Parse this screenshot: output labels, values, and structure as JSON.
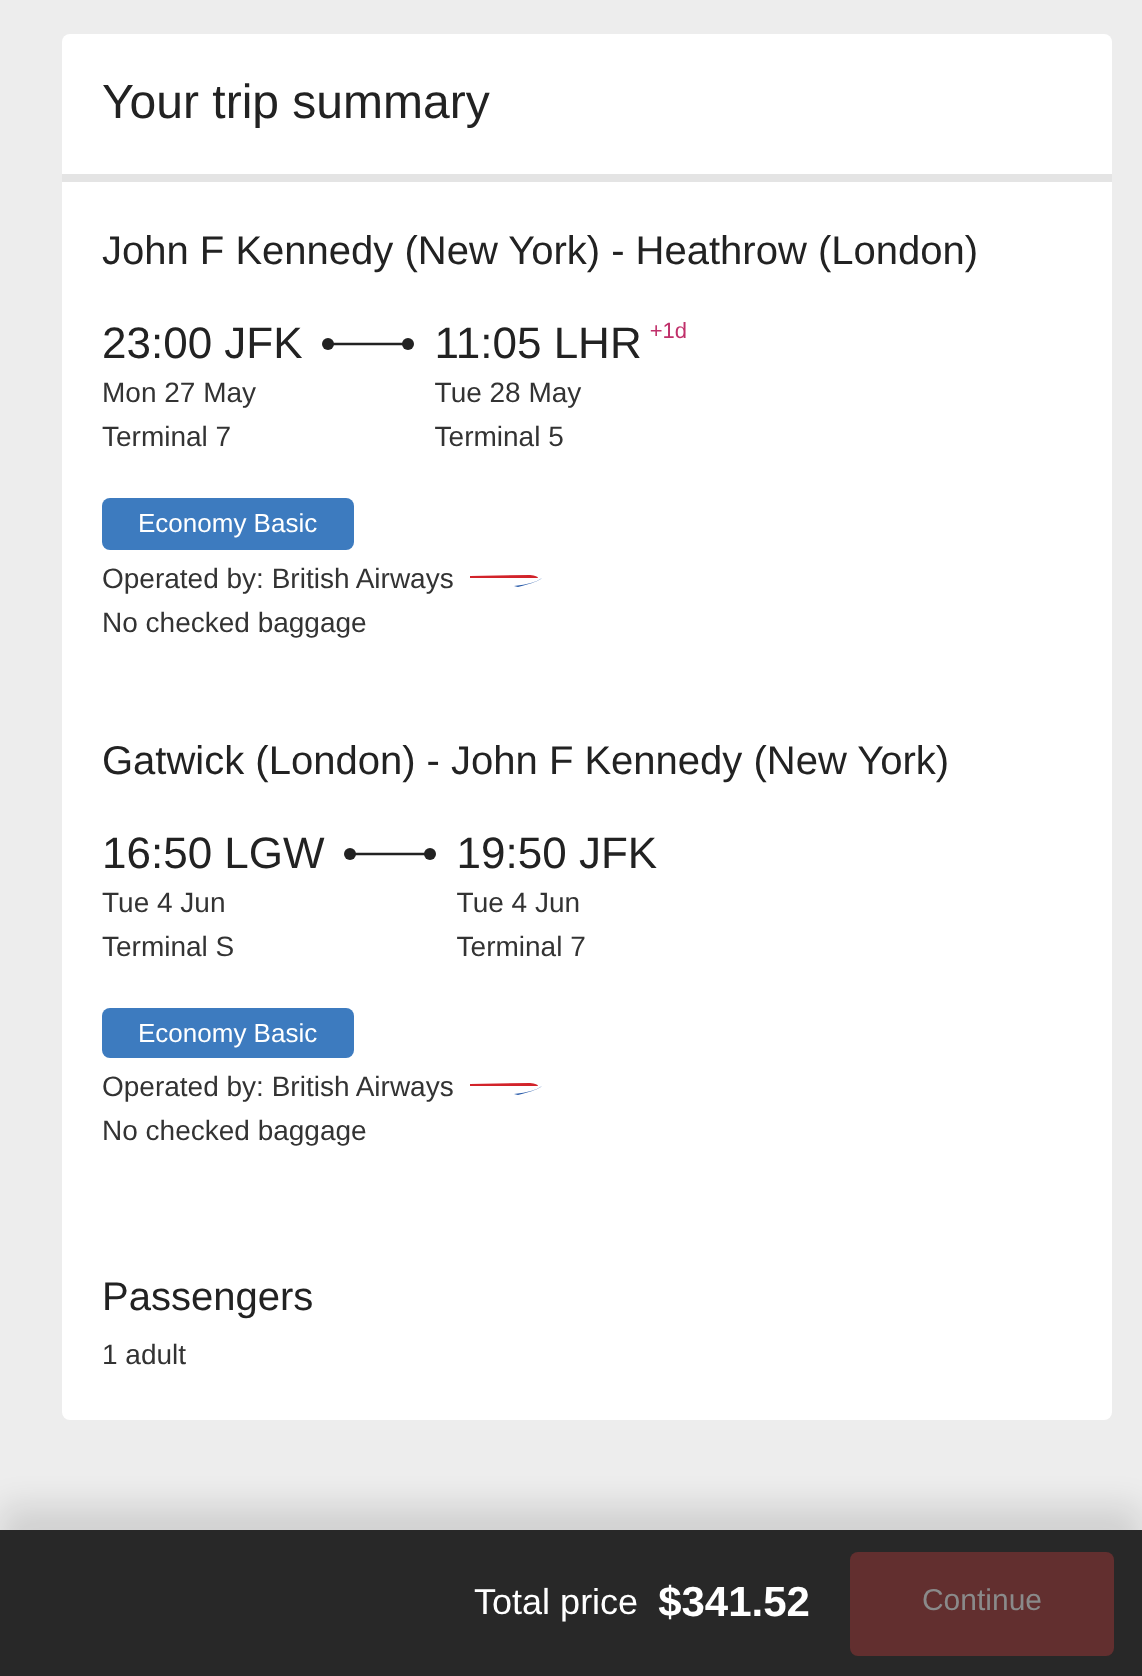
{
  "header": {
    "title": "Your trip summary"
  },
  "flights": [
    {
      "route": "John F Kennedy (New York) - Heathrow (London)",
      "departure": {
        "time": "23:00 JFK",
        "date": "Mon 27 May",
        "terminal": "Terminal 7"
      },
      "arrival": {
        "time": "11:05 LHR",
        "day_offset": "+1d",
        "date": "Tue 28 May",
        "terminal": "Terminal 5"
      },
      "fare": "Economy Basic",
      "operator": "Operated by: British Airways",
      "baggage": "No checked baggage"
    },
    {
      "route": "Gatwick (London) - John F Kennedy (New York)",
      "departure": {
        "time": "16:50 LGW",
        "date": "Tue 4 Jun",
        "terminal": "Terminal S"
      },
      "arrival": {
        "time": "19:50 JFK",
        "date": "Tue 4 Jun",
        "terminal": "Terminal 7"
      },
      "fare": "Economy Basic",
      "operator": "Operated by: British Airways",
      "baggage": "No checked baggage"
    }
  ],
  "passengers": {
    "title": "Passengers",
    "summary": "1 adult"
  },
  "footer": {
    "label": "Total price",
    "price": "$341.52",
    "button": {
      "label": "Continue",
      "disabled": true
    }
  }
}
